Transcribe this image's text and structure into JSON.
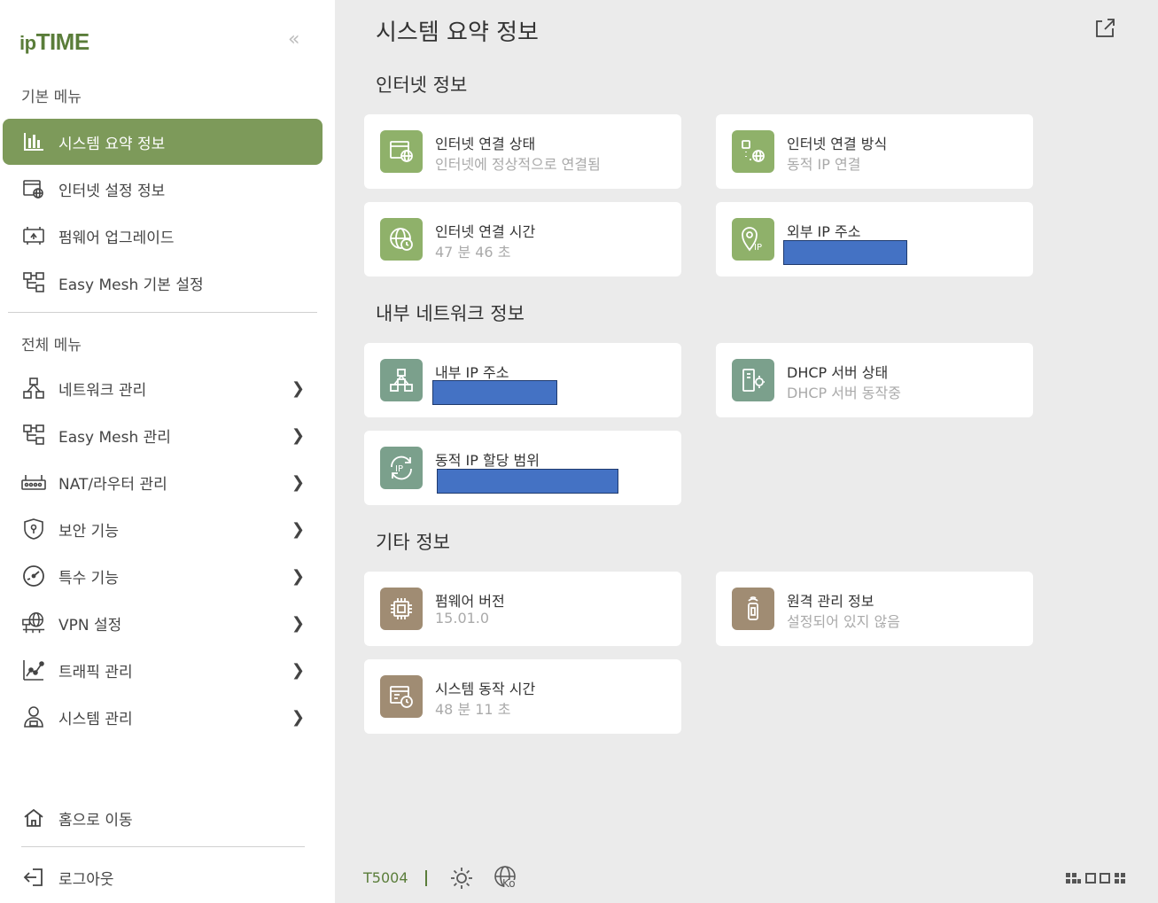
{
  "brand": {
    "logo_ip": "ip",
    "logo_time": "TIME"
  },
  "sidebar": {
    "collapse_label": "«",
    "basic_title": "기본 메뉴",
    "basic_items": [
      {
        "label": "시스템 요약 정보",
        "icon": "bar-chart-icon",
        "active": true
      },
      {
        "label": "인터넷 설정 정보",
        "icon": "internet-settings-icon"
      },
      {
        "label": "펌웨어 업그레이드",
        "icon": "firmware-upgrade-icon"
      },
      {
        "label": "Easy Mesh 기본 설정",
        "icon": "mesh-icon"
      }
    ],
    "full_title": "전체 메뉴",
    "full_items": [
      {
        "label": "네트워크 관리",
        "icon": "network-icon"
      },
      {
        "label": "Easy Mesh 관리",
        "icon": "mesh-icon"
      },
      {
        "label": "NAT/라우터 관리",
        "icon": "router-icon"
      },
      {
        "label": "보안 기능",
        "icon": "shield-icon"
      },
      {
        "label": "특수 기능",
        "icon": "speedometer-icon"
      },
      {
        "label": "VPN 설정",
        "icon": "vpn-icon"
      },
      {
        "label": "트래픽 관리",
        "icon": "traffic-chart-icon"
      },
      {
        "label": "시스템 관리",
        "icon": "system-user-icon"
      }
    ],
    "home_label": "홈으로 이동",
    "logout_label": "로그아웃"
  },
  "main": {
    "title": "시스템 요약 정보",
    "internet": {
      "title": "인터넷 정보",
      "status": {
        "label": "인터넷 연결 상태",
        "value": "인터넷에 정상적으로 연결됨"
      },
      "method": {
        "label": "인터넷 연결 방식",
        "value": "동적 IP 연결"
      },
      "uptime": {
        "label": "인터넷 연결 시간",
        "value": "47 분 46 초"
      },
      "external_ip": {
        "label": "외부 IP 주소"
      }
    },
    "internal": {
      "title": "내부 네트워크 정보",
      "internal_ip": {
        "label": "내부 IP 주소"
      },
      "dhcp": {
        "label": "DHCP 서버 상태",
        "value": "DHCP 서버 동작중"
      },
      "dhcp_range": {
        "label": "동적 IP 할당 범위"
      }
    },
    "other": {
      "title": "기타 정보",
      "firmware": {
        "label": "펌웨어 버전",
        "value": "15.01.0"
      },
      "remote": {
        "label": "원격 관리 정보",
        "value": "설정되어 있지 않음"
      },
      "sys_uptime": {
        "label": "시스템 동작 시간",
        "value": "48 분 11 초"
      }
    }
  },
  "footer": {
    "model": "T5004",
    "lang": "Ko"
  },
  "colors": {
    "accent": "#7d9a5a",
    "green_icon": "#8fb16a",
    "teal_icon": "#7ba08c",
    "brown_icon": "#a08c73",
    "redaction": "#4472c4"
  }
}
